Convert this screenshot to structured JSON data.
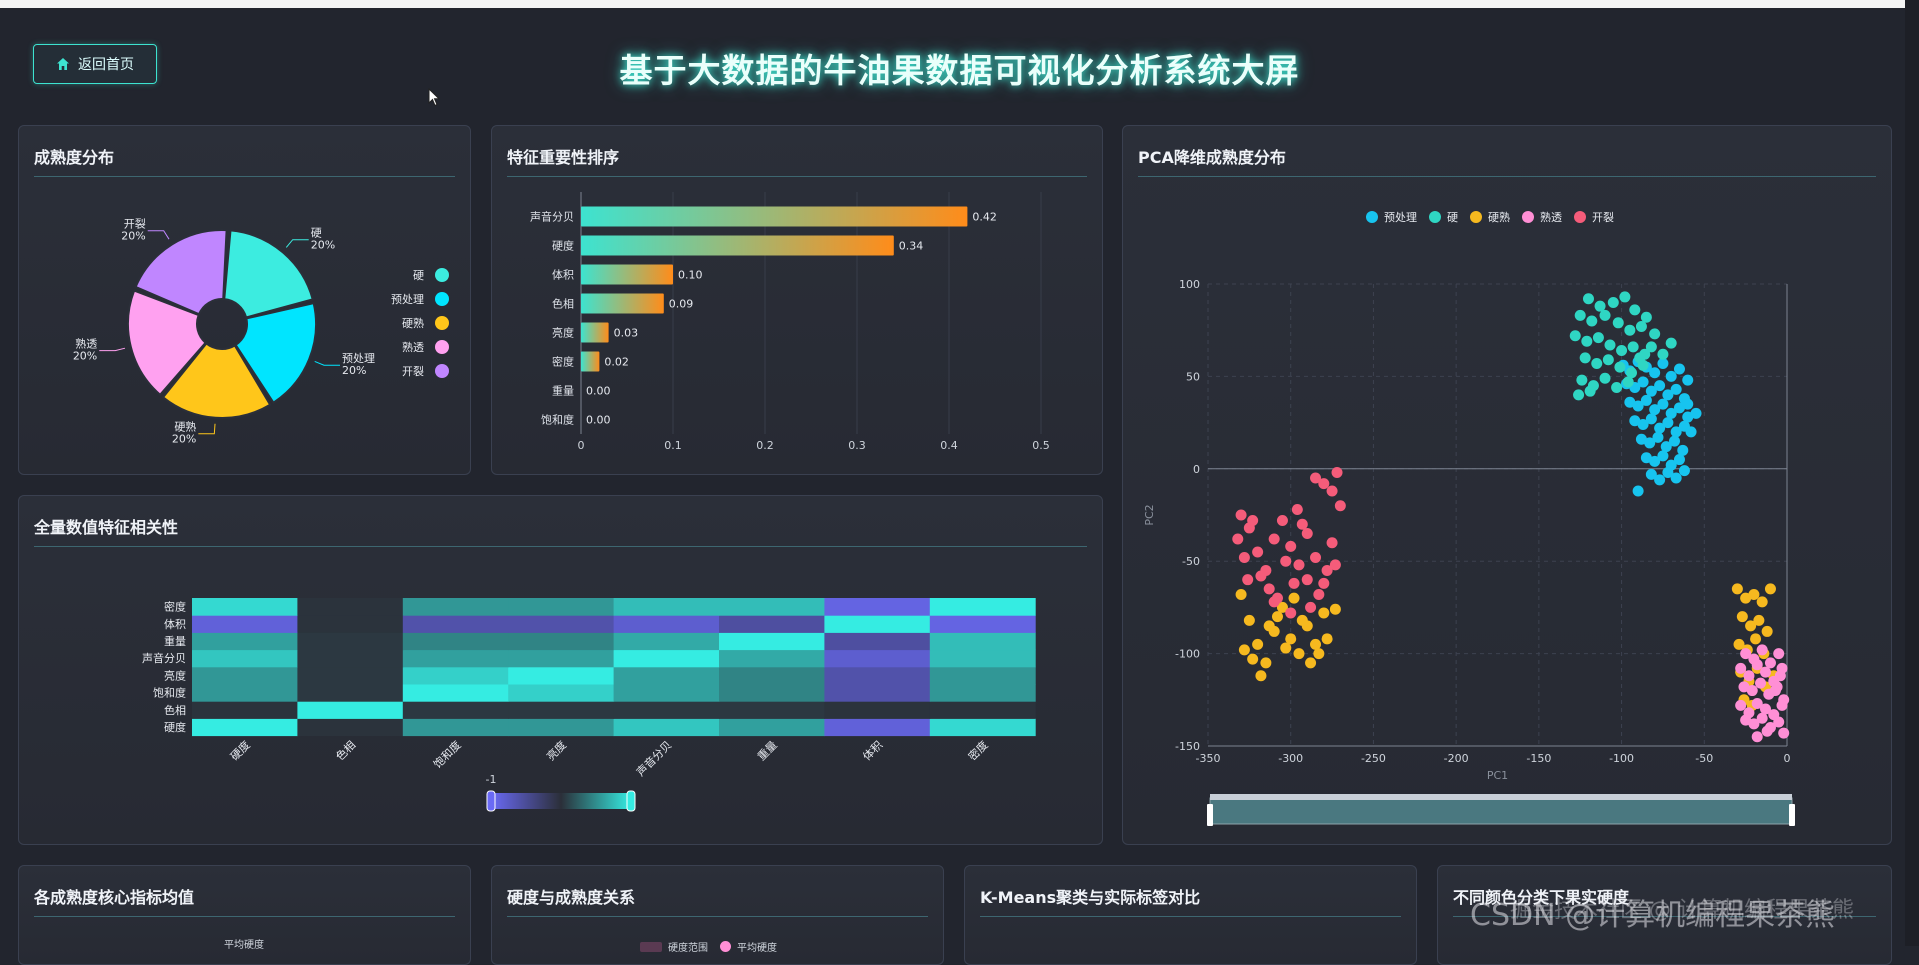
{
  "header": {
    "home_label": "返回首页",
    "title": "基于大数据的牛油果数据可视化分析系统大屏"
  },
  "panels": {
    "ripeness": "成熟度分布",
    "importance": "特征重要性排序",
    "pca": "PCA降维成熟度分布",
    "correlation": "全量数值特征相关性",
    "core_metrics": "各成熟度核心指标均值",
    "hardness": "硬度与成熟度关系",
    "kmeans": "K-Means聚类与实际标签对比",
    "color_hardness": "不同颜色分类下果实硬度"
  },
  "bottom_fragments": {
    "core_metrics_legend": "平均硬度",
    "hardness_legend": [
      "硬度范围",
      "平均硬度"
    ]
  },
  "watermark": "CSDN @计算机编程果茶熊",
  "watermark_overlay": "掘金技术社区 @ 计算机编程果茶熊",
  "colors": {
    "accent": "#3de3d0",
    "bar_start": "#3de3d0",
    "bar_end": "#ff8c1a",
    "heat_low": "#6a6af5",
    "heat_high": "#35ece2"
  },
  "chart_data": [
    {
      "type": "pie",
      "title": "成熟度分布",
      "style": "rose-donut",
      "slices": [
        {
          "name": "硬",
          "value": 20,
          "label": "20%",
          "color": "#3cece0"
        },
        {
          "name": "预处理",
          "value": 20,
          "label": "20%",
          "color": "#00e5ff"
        },
        {
          "name": "硬熟",
          "value": 20,
          "label": "20%",
          "color": "#ffc61a"
        },
        {
          "name": "熟透",
          "value": 20,
          "label": "20%",
          "color": "#ffa1f0"
        },
        {
          "name": "开裂",
          "value": 20,
          "label": "20%",
          "color": "#c086ff"
        }
      ],
      "legend_position": "right"
    },
    {
      "type": "bar",
      "orientation": "horizontal",
      "title": "特征重要性排序",
      "categories": [
        "声音分贝",
        "硬度",
        "体积",
        "色相",
        "亮度",
        "密度",
        "重量",
        "饱和度"
      ],
      "values": [
        0.42,
        0.34,
        0.1,
        0.09,
        0.03,
        0.02,
        0.0,
        0.0
      ],
      "value_labels": [
        "0.42",
        "0.34",
        "0.10",
        "0.09",
        "0.03",
        "0.02",
        "0.00",
        "0.00"
      ],
      "xlim": [
        0,
        0.5
      ],
      "xticks": [
        "0",
        "0.1",
        "0.2",
        "0.3",
        "0.4",
        "0.5"
      ]
    },
    {
      "type": "scatter",
      "title": "PCA降维成熟度分布",
      "xlabel": "PC1",
      "ylabel": "PC2",
      "xlim": [
        -350,
        0
      ],
      "ylim": [
        -150,
        100
      ],
      "xticks": [
        "-350",
        "-300",
        "-250",
        "-200",
        "-150",
        "-100",
        "-50",
        "0"
      ],
      "yticks": [
        "100",
        "50",
        "0",
        "-50",
        "-100",
        "-150"
      ],
      "legend_position": "top",
      "series": [
        {
          "name": "预处理",
          "color": "#17c4ef",
          "points": [
            [
              -99,
              56
            ],
            [
              -95,
              53
            ],
            [
              -90,
              58
            ],
            [
              -85,
              55
            ],
            [
              -80,
              52
            ],
            [
              -75,
              57
            ],
            [
              -70,
              50
            ],
            [
              -65,
              54
            ],
            [
              -60,
              48
            ],
            [
              -97,
              46
            ],
            [
              -92,
              44
            ],
            [
              -87,
              47
            ],
            [
              -82,
              42
            ],
            [
              -77,
              45
            ],
            [
              -72,
              40
            ],
            [
              -67,
              43
            ],
            [
              -62,
              38
            ],
            [
              -95,
              36
            ],
            [
              -90,
              34
            ],
            [
              -85,
              37
            ],
            [
              -80,
              32
            ],
            [
              -75,
              35
            ],
            [
              -70,
              30
            ],
            [
              -65,
              33
            ],
            [
              -60,
              28
            ],
            [
              -92,
              26
            ],
            [
              -87,
              24
            ],
            [
              -82,
              27
            ],
            [
              -77,
              22
            ],
            [
              -72,
              25
            ],
            [
              -67,
              20
            ],
            [
              -62,
              23
            ],
            [
              -88,
              16
            ],
            [
              -83,
              14
            ],
            [
              -78,
              17
            ],
            [
              -73,
              12
            ],
            [
              -68,
              15
            ],
            [
              -63,
              10
            ],
            [
              -85,
              6
            ],
            [
              -80,
              4
            ],
            [
              -75,
              7
            ],
            [
              -70,
              2
            ],
            [
              -65,
              5
            ],
            [
              -82,
              -3
            ],
            [
              -77,
              -6
            ],
            [
              -72,
              -2
            ],
            [
              -67,
              -5
            ],
            [
              -62,
              -1
            ],
            [
              -90,
              -12
            ],
            [
              -58,
              20
            ],
            [
              -60,
              35
            ],
            [
              -55,
              30
            ]
          ]
        },
        {
          "name": "硬",
          "color": "#2fd6c3",
          "points": [
            [
              -120,
              92
            ],
            [
              -113,
              88
            ],
            [
              -105,
              90
            ],
            [
              -98,
              93
            ],
            [
              -92,
              86
            ],
            [
              -85,
              82
            ],
            [
              -125,
              83
            ],
            [
              -118,
              80
            ],
            [
              -110,
              83
            ],
            [
              -102,
              79
            ],
            [
              -95,
              75
            ],
            [
              -88,
              77
            ],
            [
              -80,
              73
            ],
            [
              -128,
              72
            ],
            [
              -121,
              69
            ],
            [
              -114,
              71
            ],
            [
              -107,
              67
            ],
            [
              -100,
              64
            ],
            [
              -93,
              66
            ],
            [
              -86,
              62
            ],
            [
              -122,
              60
            ],
            [
              -115,
              57
            ],
            [
              -108,
              59
            ],
            [
              -101,
              55
            ],
            [
              -94,
              52
            ],
            [
              -87,
              56
            ],
            [
              -124,
              48
            ],
            [
              -117,
              45
            ],
            [
              -110,
              49
            ],
            [
              -103,
              44
            ],
            [
              -96,
              47
            ],
            [
              -126,
              40
            ],
            [
              -119,
              42
            ],
            [
              -89,
              60
            ],
            [
              -82,
              66
            ],
            [
              -75,
              62
            ],
            [
              -70,
              68
            ]
          ]
        },
        {
          "name": "硬熟",
          "color": "#f6b91f",
          "points": [
            [
              -330,
              -68
            ],
            [
              -325,
              -82
            ],
            [
              -320,
              -95
            ],
            [
              -315,
              -105
            ],
            [
              -310,
              -88
            ],
            [
              -305,
              -75
            ],
            [
              -300,
              -92
            ],
            [
              -295,
              -100
            ],
            [
              -290,
              -85
            ],
            [
              -285,
              -95
            ],
            [
              -280,
              -78
            ],
            [
              -328,
              -98
            ],
            [
              -318,
              -112
            ],
            [
              -308,
              -80
            ],
            [
              -298,
              -70
            ],
            [
              -288,
              -105
            ],
            [
              -278,
              -92
            ],
            [
              -273,
              -76
            ],
            [
              -323,
              -103
            ],
            [
              -313,
              -85
            ],
            [
              -303,
              -97
            ],
            [
              -293,
              -82
            ],
            [
              -283,
              -100
            ],
            [
              -30,
              -65
            ],
            [
              -25,
              -70
            ],
            [
              -20,
              -68
            ],
            [
              -15,
              -72
            ],
            [
              -10,
              -65
            ],
            [
              -27,
              -80
            ],
            [
              -22,
              -85
            ],
            [
              -17,
              -82
            ],
            [
              -12,
              -88
            ],
            [
              -29,
              -95
            ],
            [
              -24,
              -98
            ],
            [
              -19,
              -92
            ],
            [
              -14,
              -100
            ],
            [
              -28,
              -110
            ],
            [
              -23,
              -115
            ],
            [
              -18,
              -108
            ],
            [
              -13,
              -118
            ],
            [
              -8,
              -112
            ],
            [
              -26,
              -125
            ],
            [
              -21,
              -128
            ]
          ]
        },
        {
          "name": "熟透",
          "color": "#ff8fd5",
          "points": [
            [
              -25,
              -100
            ],
            [
              -20,
              -103
            ],
            [
              -15,
              -98
            ],
            [
              -10,
              -105
            ],
            [
              -5,
              -100
            ],
            [
              -28,
              -108
            ],
            [
              -23,
              -112
            ],
            [
              -18,
              -106
            ],
            [
              -13,
              -110
            ],
            [
              -8,
              -115
            ],
            [
              -3,
              -108
            ],
            [
              -26,
              -118
            ],
            [
              -21,
              -120
            ],
            [
              -16,
              -116
            ],
            [
              -11,
              -122
            ],
            [
              -6,
              -118
            ],
            [
              -2,
              -125
            ],
            [
              -28,
              -128
            ],
            [
              -23,
              -132
            ],
            [
              -18,
              -127
            ],
            [
              -13,
              -130
            ],
            [
              -8,
              -133
            ],
            [
              -3,
              -128
            ],
            [
              -25,
              -136
            ],
            [
              -20,
              -138
            ],
            [
              -15,
              -135
            ],
            [
              -10,
              -140
            ],
            [
              -5,
              -137
            ],
            [
              -2,
              -143
            ],
            [
              -18,
              -145
            ],
            [
              -12,
              -142
            ],
            [
              -7,
              -120
            ],
            [
              -4,
              -112
            ]
          ]
        },
        {
          "name": "开裂",
          "color": "#f55c7a",
          "points": [
            [
              -330,
              -25
            ],
            [
              -325,
              -32
            ],
            [
              -320,
              -45
            ],
            [
              -315,
              -55
            ],
            [
              -310,
              -38
            ],
            [
              -305,
              -28
            ],
            [
              -300,
              -42
            ],
            [
              -295,
              -52
            ],
            [
              -290,
              -35
            ],
            [
              -285,
              -48
            ],
            [
              -280,
              -62
            ],
            [
              -275,
              -40
            ],
            [
              -328,
              -48
            ],
            [
              -318,
              -58
            ],
            [
              -308,
              -70
            ],
            [
              -298,
              -62
            ],
            [
              -288,
              -75
            ],
            [
              -278,
              -55
            ],
            [
              -323,
              -28
            ],
            [
              -313,
              -65
            ],
            [
              -303,
              -50
            ],
            [
              -293,
              -30
            ],
            [
              -283,
              -68
            ],
            [
              -273,
              -52
            ],
            [
              -270,
              -20
            ],
            [
              -275,
              -12
            ],
            [
              -280,
              -8
            ],
            [
              -285,
              -5
            ],
            [
              -272,
              -2
            ],
            [
              -310,
              -72
            ],
            [
              -300,
              -78
            ],
            [
              -290,
              -60
            ],
            [
              -332,
              -38
            ],
            [
              -326,
              -60
            ],
            [
              -296,
              -22
            ]
          ]
        }
      ]
    },
    {
      "type": "heatmap",
      "title": "全量数值特征相关性",
      "x_categories": [
        "硬度",
        "色相",
        "饱和度",
        "亮度",
        "声音分贝",
        "重量",
        "体积",
        "密度"
      ],
      "y_categories": [
        "硬度",
        "色相",
        "饱和度",
        "亮度",
        "声音分贝",
        "重量",
        "体积",
        "密度"
      ],
      "range": [
        -1,
        1
      ],
      "range_label": "-1",
      "matrix": [
        [
          1.0,
          0.02,
          0.55,
          0.55,
          0.8,
          0.6,
          -0.85,
          0.9
        ],
        [
          0.02,
          1.0,
          0.05,
          0.05,
          0.05,
          0.05,
          0.02,
          0.02
        ],
        [
          0.55,
          0.05,
          1.0,
          0.85,
          0.6,
          0.45,
          -0.6,
          0.55
        ],
        [
          0.55,
          0.05,
          0.85,
          1.0,
          0.6,
          0.45,
          -0.6,
          0.55
        ],
        [
          0.8,
          0.05,
          0.6,
          0.6,
          1.0,
          0.65,
          -0.8,
          0.75
        ],
        [
          0.6,
          0.05,
          0.45,
          0.45,
          0.65,
          1.0,
          -0.55,
          0.75
        ],
        [
          -0.85,
          0.02,
          -0.6,
          -0.6,
          -0.8,
          -0.55,
          1.0,
          -0.9
        ],
        [
          0.9,
          0.02,
          0.55,
          0.55,
          0.75,
          0.75,
          -0.9,
          1.0
        ]
      ]
    }
  ]
}
